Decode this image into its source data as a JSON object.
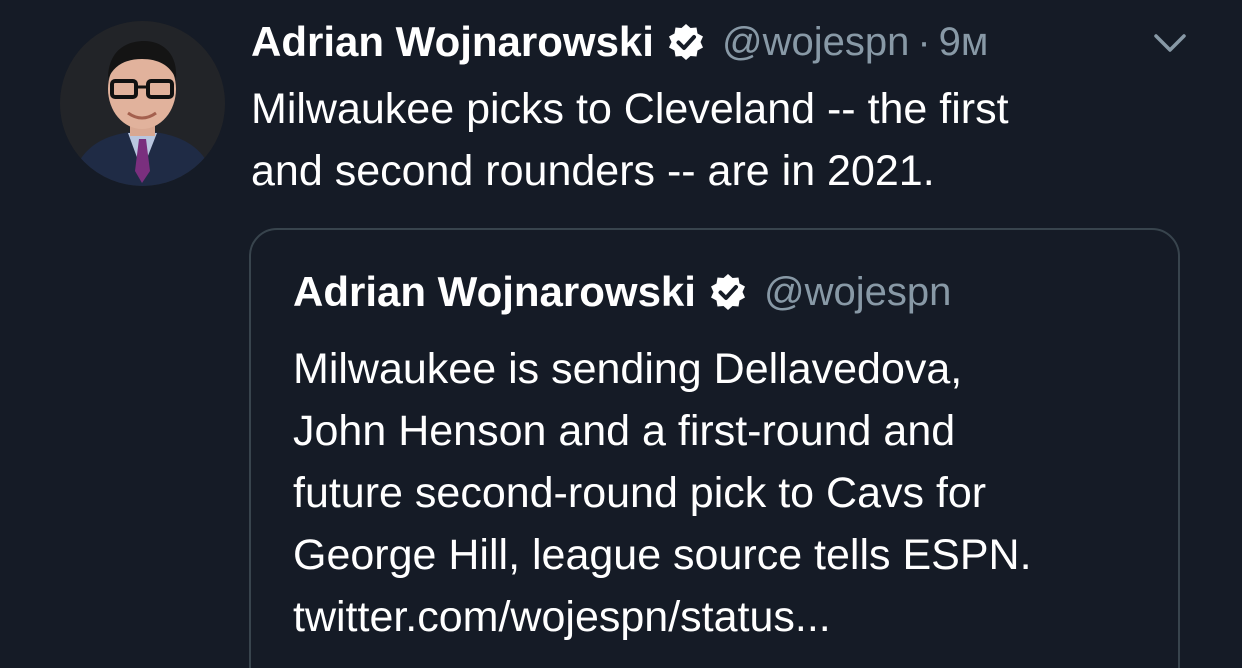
{
  "tweet": {
    "author_name": "Adrian Wojnarowski",
    "handle": "@wojespn",
    "separator": "·",
    "time": "9м",
    "text_lines": [
      "Milwaukee picks to Cleveland -- the first",
      "and second rounders -- are in 2021."
    ]
  },
  "quoted_tweet": {
    "author_name": "Adrian Wojnarowski",
    "handle": "@wojespn",
    "text_lines": [
      "Milwaukee is sending Dellavedova,",
      "John Henson and a first-round and",
      "future second-round pick to Cavs for",
      "George Hill, league source tells ESPN.",
      "twitter.com/wojespn/status..."
    ]
  },
  "colors": {
    "background": "#151b26",
    "primary_text": "#ffffff",
    "secondary_text": "#8899a6",
    "card_border": "#38444d"
  },
  "icons": {
    "verified": "verified-badge-icon",
    "menu": "chevron-down-icon",
    "avatar": "profile-photo"
  }
}
